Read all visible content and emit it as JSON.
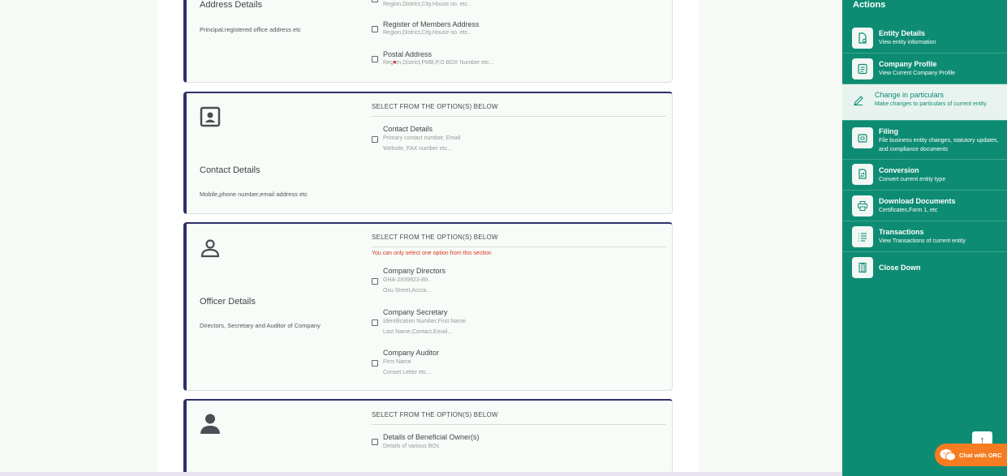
{
  "address_card": {
    "title": "Address Details",
    "subtitle": "Principal,registered office address etc",
    "options": [
      {
        "sub": "Region,District,City,House no. etc.."
      },
      {
        "title": "Register of Members Address",
        "sub": "Region,District,City,House no. etc.."
      },
      {
        "title": "Postal Address",
        "sub": "Region,District,PMB,P.O BOX Number etc..."
      }
    ]
  },
  "contact_card": {
    "select_heading": "SELECT FROM THE OPTION(S) BELOW",
    "title": "Contact Details",
    "subtitle": "Mobile,phone number,email address etc",
    "option": {
      "title": "Contact Details",
      "sub1": "Primary contact number, Email",
      "sub2": "Website, FAX number etc..."
    }
  },
  "officer_card": {
    "select_heading": "SELECT FROM THE OPTION(S) BELOW",
    "warning": "You can only select one option from this section",
    "title": "Officer Details",
    "subtitle": "Directors, Secretary and Auditor of Company",
    "options": [
      {
        "title": "Company Directors",
        "sub1": "GHA-2839823-89..",
        "sub2": "Osu Street,Accra..."
      },
      {
        "title": "Company Secretary",
        "sub1": "Identification Number,First Name",
        "sub2": "Last Name,Contact,Email..."
      },
      {
        "title": "Company Auditor",
        "sub1": "Firm Name",
        "sub2": "Conset Letter etc..."
      }
    ]
  },
  "bo_card": {
    "select_heading": "SELECT FROM THE OPTION(S) BELOW",
    "option": {
      "title": "Details of Beneficial Owner(s)",
      "sub": "Details of various BOs"
    }
  },
  "sidebar": {
    "title": "Actions",
    "items": [
      {
        "label": "Entity Details",
        "desc": "View entity information",
        "icon": "document-eye-icon"
      },
      {
        "label": "Company Profile",
        "desc": "View Current Company Profile",
        "icon": "profile-icon"
      },
      {
        "label": "Change in particulars",
        "desc": "Make changes to particulars of current entity",
        "icon": "pencil-icon"
      },
      {
        "label": "Filing",
        "desc": "File business entity changes, statutory updates, and compliance documents",
        "icon": "folder-icon"
      },
      {
        "label": "Conversion",
        "desc": "Convert current entity type",
        "icon": "convert-icon"
      },
      {
        "label": "Download Documents",
        "desc": "Certificates,Form 1, etc",
        "icon": "printer-icon"
      },
      {
        "label": "Transactions",
        "desc": "View Transactions of current entity",
        "icon": "list-icon"
      },
      {
        "label": "Close Down",
        "desc": "",
        "icon": "door-icon"
      }
    ]
  },
  "chat": {
    "label": "Chat with ORC"
  },
  "colors": {
    "sidebar": "#0e8c73",
    "card_accent": "#2e3066",
    "chat": "#f57c21",
    "warning": "#d9351f"
  }
}
